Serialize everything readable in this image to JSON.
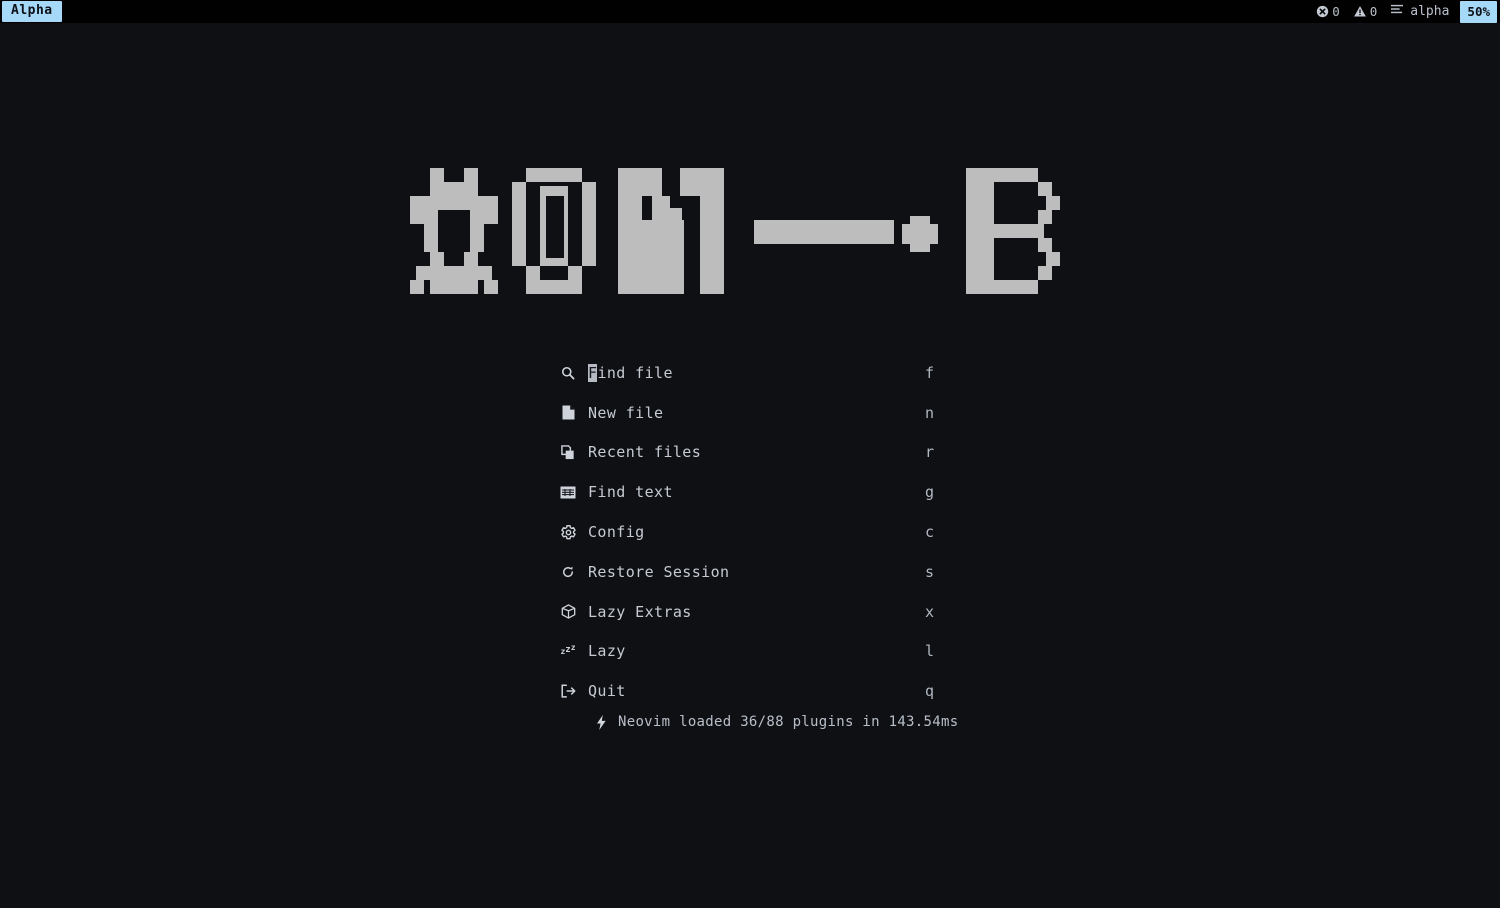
{
  "window": {
    "background_color": "#0e1014",
    "accent_color": "#a6d8f7",
    "text_color": "#c6cbd3"
  },
  "tabline": {
    "active_tab": "Alpha",
    "diagnostics": [
      {
        "icon": "error-icon",
        "count": "0"
      },
      {
        "icon": "warning-icon",
        "count": "0"
      }
    ],
    "mode_icon": "lines-icon",
    "mode_label": "alpha",
    "scroll_percent": "50%"
  },
  "logo": {
    "alt": "neovim-ascii-logo",
    "glyphs": "☷ OM—•B"
  },
  "menu": {
    "items": [
      {
        "icon": "search-icon",
        "label": "Find file",
        "cursor_char": "F",
        "rest": "ind file",
        "key": "f"
      },
      {
        "icon": "new-file-icon",
        "label": "New file",
        "key": "n"
      },
      {
        "icon": "recent-files-icon",
        "label": "Recent files",
        "key": "r"
      },
      {
        "icon": "find-text-icon",
        "label": "Find text",
        "key": "g"
      },
      {
        "icon": "gear-icon",
        "label": "Config",
        "key": "c"
      },
      {
        "icon": "restore-icon",
        "label": "Restore Session",
        "key": "s"
      },
      {
        "icon": "package-icon",
        "label": "Lazy Extras",
        "key": "x"
      },
      {
        "icon": "sleep-icon",
        "label": "Lazy",
        "key": "l"
      },
      {
        "icon": "exit-icon",
        "label": "Quit",
        "key": "q"
      }
    ]
  },
  "footer": {
    "icon": "lightning-icon",
    "text": "Neovim loaded 36/88 plugins in 143.54ms"
  }
}
